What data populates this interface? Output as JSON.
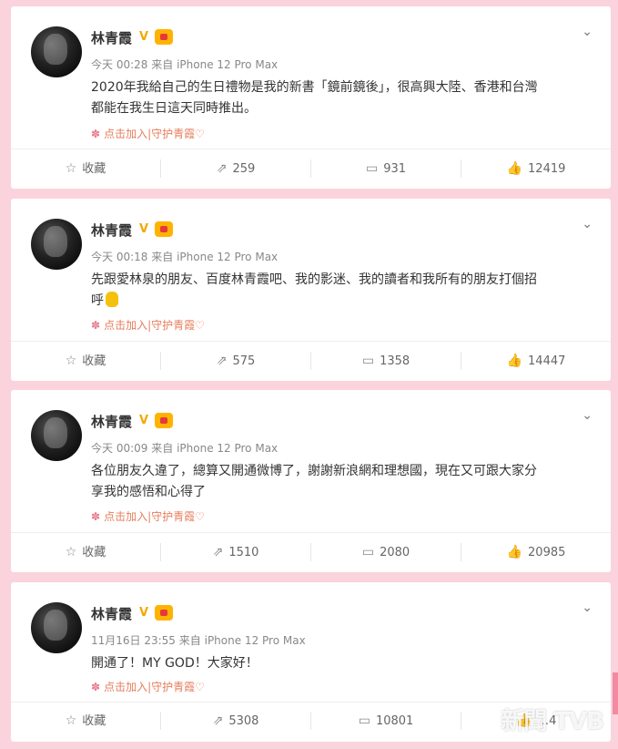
{
  "posts": [
    {
      "author": "林青霞",
      "verified_mark": "V",
      "time": "今天 00:28",
      "source_prefix": "来自",
      "device": "iPhone 12 Pro Max",
      "text_line1": "2020年我給自己的生日禮物是我的新書「鏡前鏡後」，很高興大陸、香港和台灣",
      "text_line2": "都能在我生日這天同時推出。",
      "fan_tail": "点击加入|守护青霞♡",
      "collect_label": "收藏",
      "repost_count": "259",
      "comment_count": "931",
      "like_count": "12419"
    },
    {
      "author": "林青霞",
      "verified_mark": "V",
      "time": "今天 00:18",
      "source_prefix": "来自",
      "device": "iPhone 12 Pro Max",
      "text_line1": "先跟愛林泉的朋友、百度林青霞吧、我的影迷、我的讀者和我所有的朋友打個招",
      "text_line2": "呼",
      "fan_tail": "点击加入|守护青霞♡",
      "collect_label": "收藏",
      "repost_count": "575",
      "comment_count": "1358",
      "like_count": "14447"
    },
    {
      "author": "林青霞",
      "verified_mark": "V",
      "time": "今天 00:09",
      "source_prefix": "来自",
      "device": "iPhone 12 Pro Max",
      "text_line1": "各位朋友久違了，總算又開通微博了，謝謝新浪網和理想國，現在又可跟大家分",
      "text_line2": "享我的感悟和心得了",
      "fan_tail": "点击加入|守护青霞♡",
      "collect_label": "收藏",
      "repost_count": "1510",
      "comment_count": "2080",
      "like_count": "20985"
    },
    {
      "author": "林青霞",
      "verified_mark": "V",
      "time": "11月16日 23:55",
      "source_prefix": "来自",
      "device": "iPhone 12 Pro Max",
      "text_line1": "開通了！MY GOD！大家好！",
      "text_line2": "",
      "fan_tail": "点击加入|守护青霞♡",
      "collect_label": "收藏",
      "repost_count": "5308",
      "comment_count": "10801",
      "like_count": "…4"
    }
  ],
  "icons": {
    "collect": "star-outline-icon",
    "repost": "repost-icon",
    "comment": "comment-icon",
    "like": "thumbs-up-icon",
    "menu": "chevron-down-icon"
  },
  "watermark": "新聞 TVB",
  "colors": {
    "background": "#fbd3dc",
    "verified": "#f6a800",
    "tail": "#e67e5c"
  }
}
